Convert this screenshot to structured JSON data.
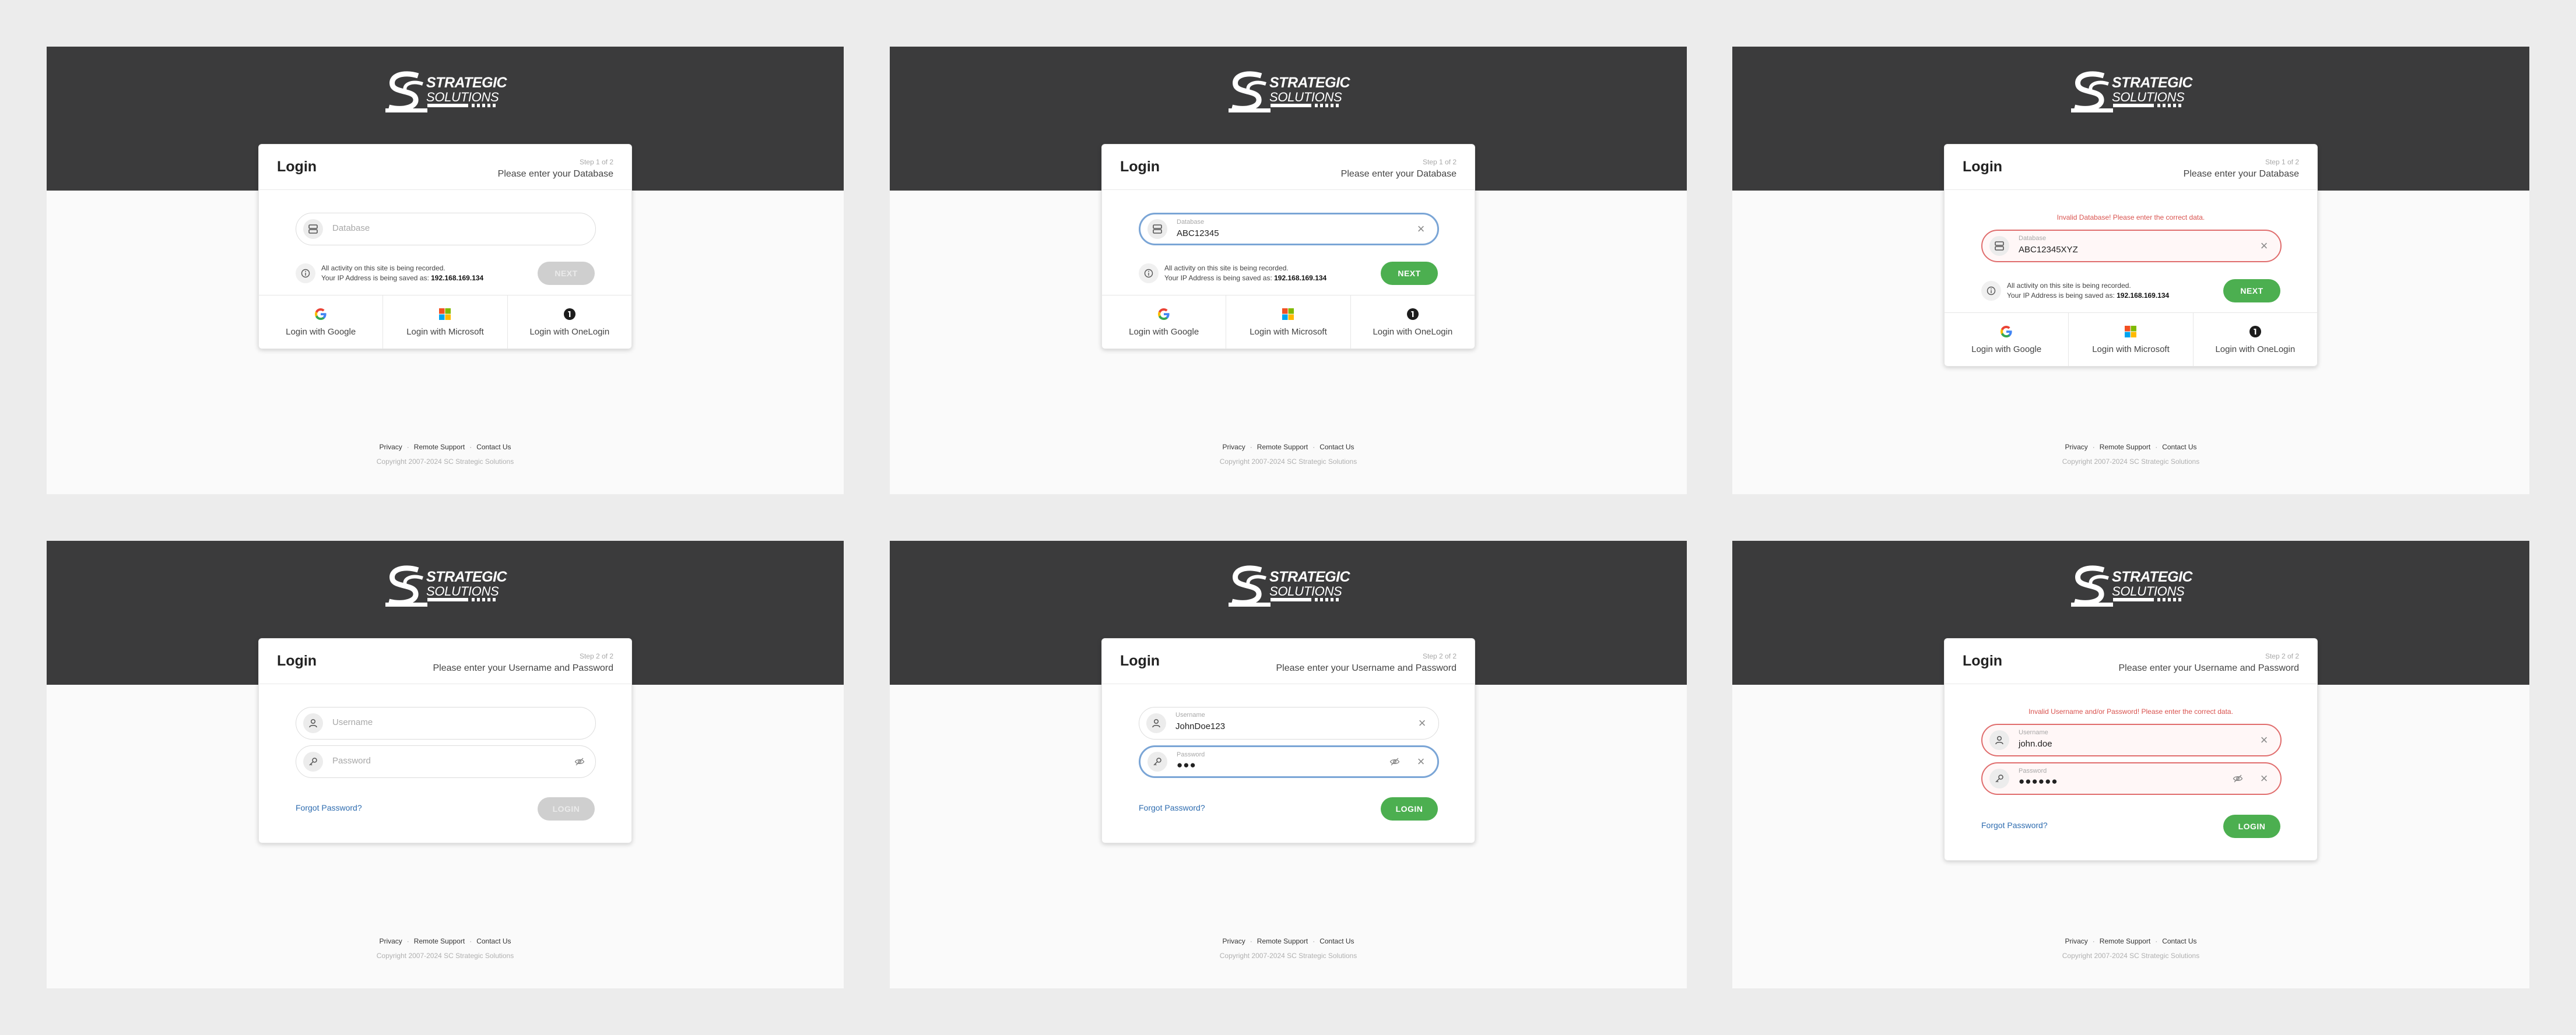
{
  "brand": {
    "line1": "STRATEGIC",
    "line2": "SOLUTIONS"
  },
  "common": {
    "title": "Login",
    "step1": "Step 1 of 2",
    "step2": "Step 2 of 2",
    "sub1": "Please enter your Database",
    "sub2": "Please enter your Username and Password",
    "db_placeholder": "Database",
    "db_label": "Database",
    "user_placeholder": "Username",
    "user_label": "Username",
    "pass_placeholder": "Password",
    "pass_label": "Password",
    "info_line1": "All activity on this site is being recorded.",
    "info_line2_prefix": "Your IP Address is being saved as: ",
    "ip": "192.168.169.134",
    "next": "NEXT",
    "login": "LOGIN",
    "forgot": "Forgot Password?",
    "sso_google": "Login with Google",
    "sso_microsoft": "Login with Microsoft",
    "sso_onelogin": "Login with OneLogin",
    "footer_privacy": "Privacy",
    "footer_support": "Remote Support",
    "footer_contact": "Contact Us",
    "copyright": "Copyright 2007-2024 SC Strategic Solutions"
  },
  "screens": {
    "db_filled_value": "ABC12345",
    "db_error_value": "ABC12345XYZ",
    "db_error_msg": "Invalid Database! Please enter the correct data.",
    "user_filled_value": "JohnDoe123",
    "pass_filled_value": "●●●",
    "user_error_value": "john.doe",
    "pass_error_value": "●●●●●●",
    "cred_error_msg": "Invalid Username and/or Password! Please enter the correct data."
  },
  "colors": {
    "band": "#3b3b3c",
    "accent_green": "#4caf50",
    "error_red": "#d9534f",
    "focus_blue": "#7aa5d6",
    "link_blue": "#2f6db0"
  },
  "icons": [
    "database-icon",
    "info-icon",
    "user-icon",
    "key-icon",
    "eye-off-icon",
    "clear-icon",
    "google-icon",
    "microsoft-icon",
    "onelogin-icon"
  ]
}
